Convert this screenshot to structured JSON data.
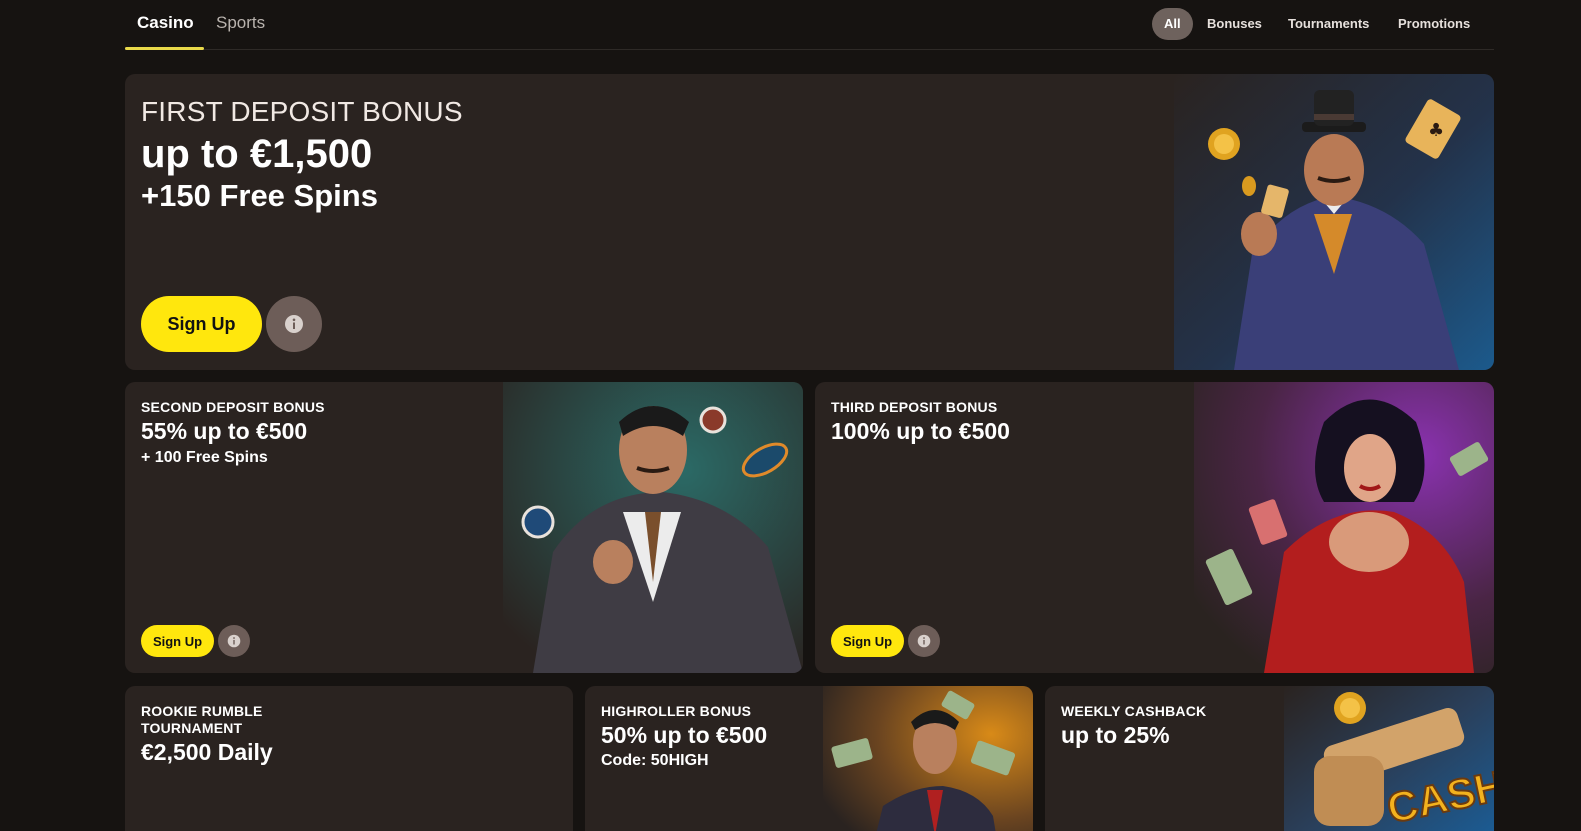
{
  "nav": {
    "tabs": [
      {
        "label": "Casino",
        "active": true
      },
      {
        "label": "Sports",
        "active": false
      }
    ],
    "filters": [
      {
        "label": "All",
        "active": true
      },
      {
        "label": "Bonuses",
        "active": false
      },
      {
        "label": "Tournaments",
        "active": false
      },
      {
        "label": "Promotions",
        "active": false
      }
    ]
  },
  "colors": {
    "background": "#161311",
    "card": "#2a2320",
    "accent_yellow": "#ffe70d",
    "info_button": "#6d5d58",
    "tab_underline": "#e8d94a"
  },
  "promos": {
    "first": {
      "kicker": "FIRST DEPOSIT BONUS",
      "headline": "up to €1,500",
      "sub": "+150 Free Spins",
      "cta": "Sign Up",
      "info_icon": "info-icon",
      "art": "gangster-with-cards-illustration"
    },
    "second": {
      "kicker": "SECOND DEPOSIT BONUS",
      "headline": "55% up to €500",
      "sub": "+ 100 Free Spins",
      "cta": "Sign Up",
      "info_icon": "info-icon",
      "art": "gangster-with-chips-illustration"
    },
    "third": {
      "kicker": "THIRD DEPOSIT BONUS",
      "headline": "100% up to €500",
      "cta": "Sign Up",
      "info_icon": "info-icon",
      "art": "woman-in-red-dress-illustration"
    },
    "rookie": {
      "kicker_line1": "ROOKIE RUMBLE",
      "kicker_line2": "TOURNAMENT",
      "headline": "€2,500 Daily"
    },
    "highroller": {
      "kicker": "HIGHROLLER BONUS",
      "headline": "50% up to €500",
      "sub": "Code: 50HIGH",
      "art": "gangster-with-money-illustration"
    },
    "cashback": {
      "kicker": "WEEKLY CASHBACK",
      "headline": "up to 25%",
      "art": "revolver-cashback-illustration",
      "art_text": "CASH"
    }
  }
}
